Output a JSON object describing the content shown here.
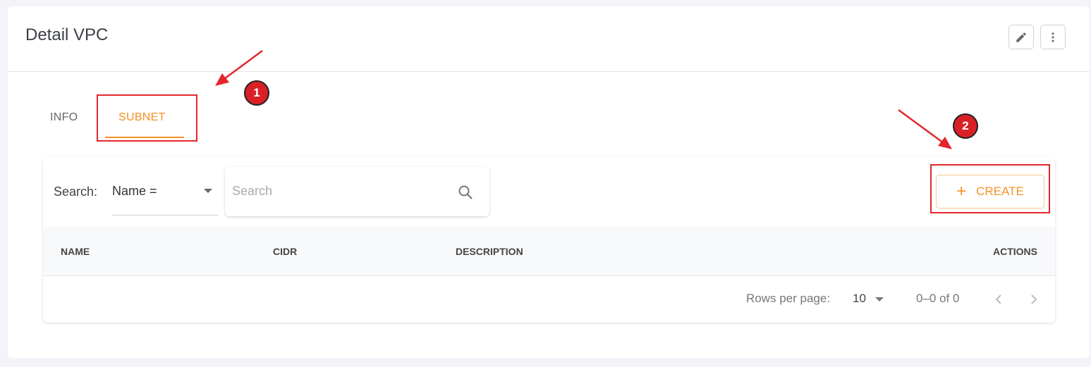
{
  "header": {
    "title": "Detail VPC",
    "edit_icon": "pencil-icon",
    "more_icon": "more-vertical-icon"
  },
  "tabs": [
    {
      "label": "INFO",
      "active": false
    },
    {
      "label": "SUBNET",
      "active": true
    }
  ],
  "toolbar": {
    "search_label": "Search:",
    "filter_value": "Name =",
    "search_placeholder": "Search",
    "create_label": "CREATE"
  },
  "table": {
    "columns": [
      "NAME",
      "CIDR",
      "DESCRIPTION",
      "ACTIONS"
    ],
    "rows": []
  },
  "pagination": {
    "rows_per_page_label": "Rows per page:",
    "rows_per_page": "10",
    "range": "0–0 of 0"
  },
  "annotations": [
    {
      "number": "1"
    },
    {
      "number": "2"
    }
  ],
  "colors": {
    "accent": "#f39223",
    "annotation": "#e3262e"
  }
}
